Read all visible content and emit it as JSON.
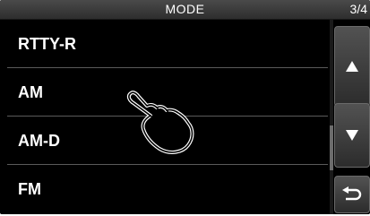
{
  "header": {
    "title": "MODE",
    "page": "3/4"
  },
  "modes": [
    "RTTY-R",
    "AM",
    "AM-D",
    "FM"
  ],
  "selected_mode": "AM",
  "controls": {
    "scroll_up_icon": "triangle-up-icon",
    "scroll_down_icon": "triangle-down-icon",
    "back_icon": "return-arrow-icon"
  },
  "overlay": {
    "icon": "pointing-hand-icon"
  },
  "colors": {
    "screen_bg": "#000000",
    "text": "#ffffff",
    "button": "#3c3c3c"
  }
}
